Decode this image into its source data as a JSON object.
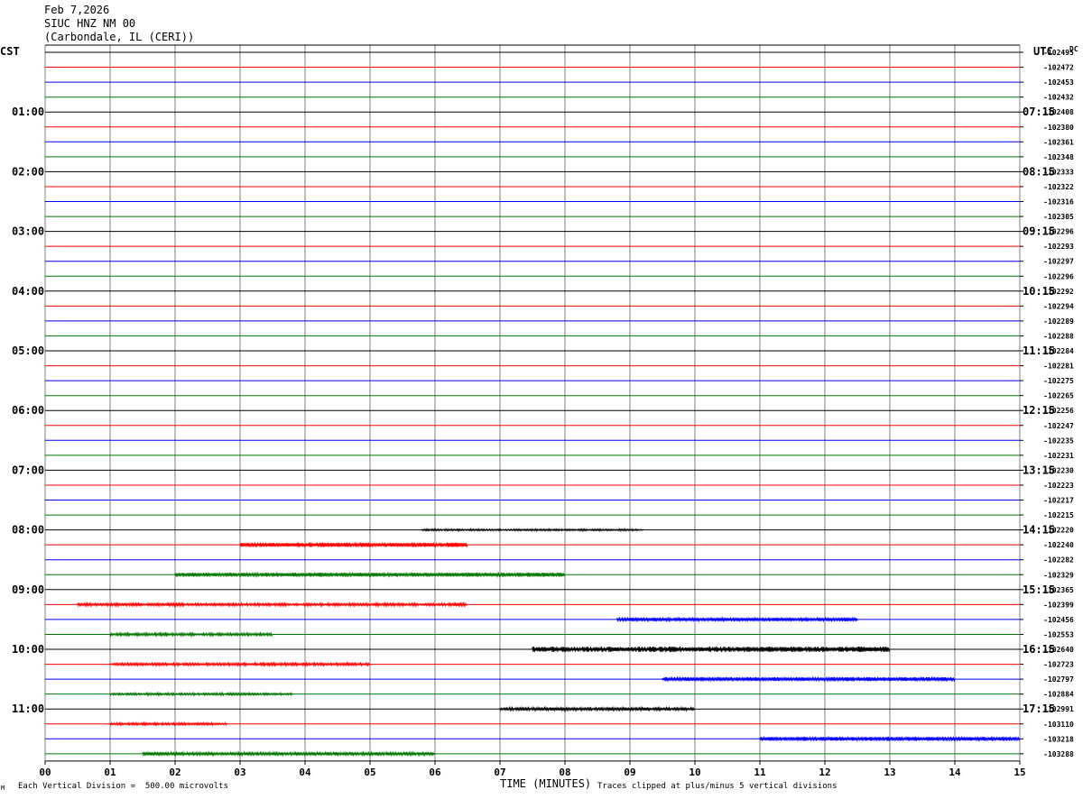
{
  "header": {
    "date": "Feb 7,2026",
    "station": "SIUC HNZ NM 00",
    "location": "(Carbondale, IL (CERI))"
  },
  "left_zone": "CST",
  "right_zone": "UTC",
  "dc_label": "DC",
  "footer": {
    "scale_note": "Each Vertical Division =  500.00 microvolts",
    "clip_note": "Traces clipped at plus/minus 5 vertical divisions",
    "corner_mark": "M"
  },
  "colors": {
    "cycle": [
      "#000000",
      "#ff0000",
      "#0000ff",
      "#007700"
    ],
    "grid": "#808080"
  },
  "chart_data": {
    "type": "line",
    "xlabel": "TIME (MINUTES)",
    "xlim": [
      0,
      15
    ],
    "x_ticks": [
      "00",
      "01",
      "02",
      "03",
      "04",
      "05",
      "06",
      "07",
      "08",
      "09",
      "10",
      "11",
      "12",
      "13",
      "14",
      "15"
    ],
    "rows_per_hour": 4,
    "left_hour_labels": [
      "01:00",
      "02:00",
      "03:00",
      "04:00",
      "05:00",
      "06:00",
      "07:00",
      "08:00",
      "09:00",
      "10:00",
      "11:00"
    ],
    "right_hour_labels": [
      "07:15",
      "08:15",
      "09:15",
      "10:15",
      "11:15",
      "12:15",
      "13:15",
      "14:15",
      "15:15",
      "16:15",
      "17:15"
    ],
    "dc_offsets": [
      "-102495",
      "-102472",
      "-102453",
      "-102432",
      "-102408",
      "-102380",
      "-102361",
      "-102348",
      "-102333",
      "-102322",
      "-102316",
      "-102305",
      "-102296",
      "-102293",
      "-102297",
      "-102296",
      "-102292",
      "-102294",
      "-102289",
      "-102288",
      "-102284",
      "-102281",
      "-102275",
      "-102265",
      "-102256",
      "-102247",
      "-102235",
      "-102231",
      "-102230",
      "-102223",
      "-102217",
      "-102215",
      "-102220",
      "-102240",
      "-102282",
      "-102329",
      "-102365",
      "-102399",
      "-102456",
      "-102553",
      "-102640",
      "-102723",
      "-102797",
      "-102884",
      "-102991",
      "-103110",
      "-103218",
      "-103288"
    ],
    "noisy_rows": [
      {
        "row": 32,
        "from": 5.8,
        "to": 9.2,
        "level": 0.4
      },
      {
        "row": 33,
        "from": 3.0,
        "to": 6.5,
        "level": 1.0
      },
      {
        "row": 35,
        "from": 2.0,
        "to": 8.0,
        "level": 0.9
      },
      {
        "row": 37,
        "from": 0.5,
        "to": 6.5,
        "level": 0.6
      },
      {
        "row": 38,
        "from": 8.8,
        "to": 12.5,
        "level": 0.8
      },
      {
        "row": 39,
        "from": 1.0,
        "to": 3.5,
        "level": 0.6
      },
      {
        "row": 40,
        "from": 7.5,
        "to": 13.0,
        "level": 1.2
      },
      {
        "row": 41,
        "from": 1.0,
        "to": 5.0,
        "level": 0.6
      },
      {
        "row": 42,
        "from": 9.5,
        "to": 14.0,
        "level": 0.9
      },
      {
        "row": 43,
        "from": 1.0,
        "to": 3.8,
        "level": 0.5
      },
      {
        "row": 44,
        "from": 7.0,
        "to": 10.0,
        "level": 0.7
      },
      {
        "row": 45,
        "from": 1.0,
        "to": 2.8,
        "level": 0.5
      },
      {
        "row": 46,
        "from": 11.0,
        "to": 15.0,
        "level": 0.9
      },
      {
        "row": 47,
        "from": 1.5,
        "to": 6.0,
        "level": 0.7
      }
    ]
  }
}
